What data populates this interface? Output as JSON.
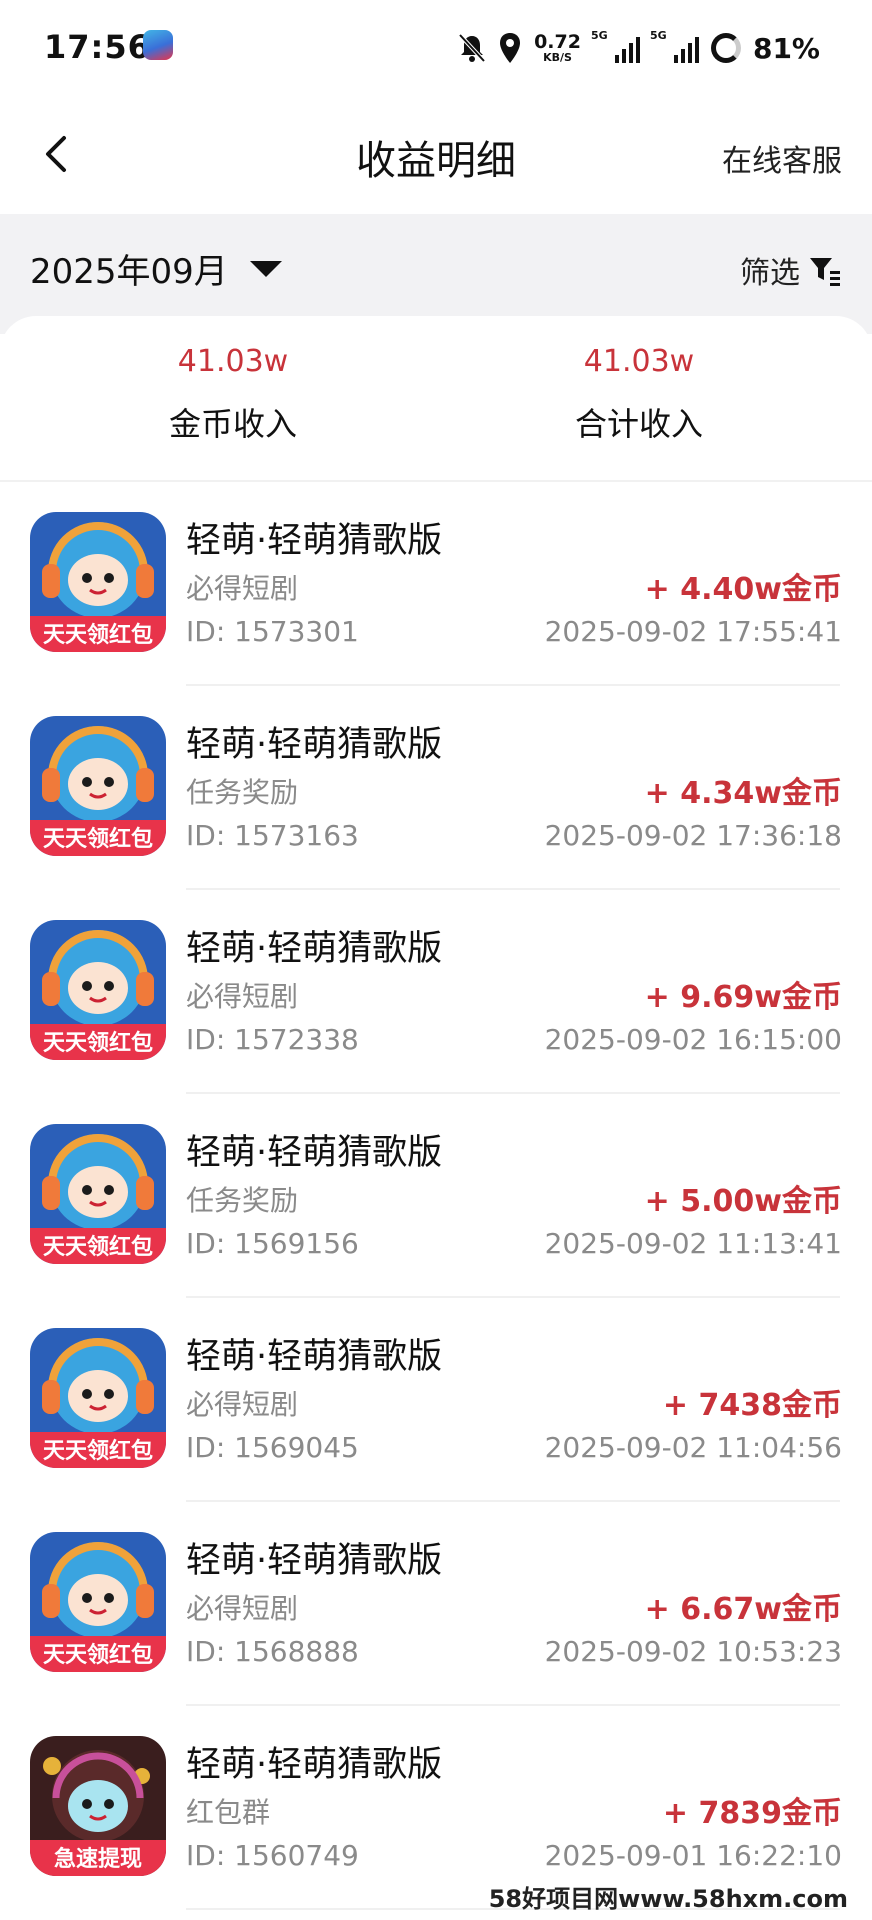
{
  "status_bar": {
    "time": "17:56",
    "net_speed_value": "0.72",
    "net_speed_unit": "KB/S",
    "signal1_label": "5G",
    "signal2_label": "5G",
    "battery": "81%"
  },
  "header": {
    "title": "收益明细",
    "service_link": "在线客服"
  },
  "month_bar": {
    "month": "2025年09月",
    "filter_label": "筛选"
  },
  "summary": {
    "coin_income_value": "41.03w",
    "coin_income_label": "金币收入",
    "total_income_value": "41.03w",
    "total_income_label": "合计收入"
  },
  "records": [
    {
      "title": "轻萌·轻萌猜歌版",
      "category": "必得短剧",
      "id": "ID: 1573301",
      "amount": "+ 4.40w金币",
      "time": "2025-09-02 17:55:41",
      "icon_banner": "天天领红包"
    },
    {
      "title": "轻萌·轻萌猜歌版",
      "category": "任务奖励",
      "id": "ID: 1573163",
      "amount": "+ 4.34w金币",
      "time": "2025-09-02 17:36:18",
      "icon_banner": "天天领红包"
    },
    {
      "title": "轻萌·轻萌猜歌版",
      "category": "必得短剧",
      "id": "ID: 1572338",
      "amount": "+ 9.69w金币",
      "time": "2025-09-02 16:15:00",
      "icon_banner": "天天领红包"
    },
    {
      "title": "轻萌·轻萌猜歌版",
      "category": "任务奖励",
      "id": "ID: 1569156",
      "amount": "+ 5.00w金币",
      "time": "2025-09-02 11:13:41",
      "icon_banner": "天天领红包"
    },
    {
      "title": "轻萌·轻萌猜歌版",
      "category": "必得短剧",
      "id": "ID: 1569045",
      "amount": "+ 7438金币",
      "time": "2025-09-02 11:04:56",
      "icon_banner": "天天领红包"
    },
    {
      "title": "轻萌·轻萌猜歌版",
      "category": "必得短剧",
      "id": "ID: 1568888",
      "amount": "+ 6.67w金币",
      "time": "2025-09-02 10:53:23",
      "icon_banner": "天天领红包"
    },
    {
      "title": "轻萌·轻萌猜歌版",
      "category": "红包群",
      "id": "ID: 1560749",
      "amount": "+ 7839金币",
      "time": "2025-09-01 16:22:10",
      "icon_banner": "急速提现"
    }
  ],
  "watermark": "58好项目网www.58hxm.com",
  "colors": {
    "accent_red": "#c8333a",
    "muted_text": "#8a8a8a",
    "band_background": "#f2f2f4"
  }
}
